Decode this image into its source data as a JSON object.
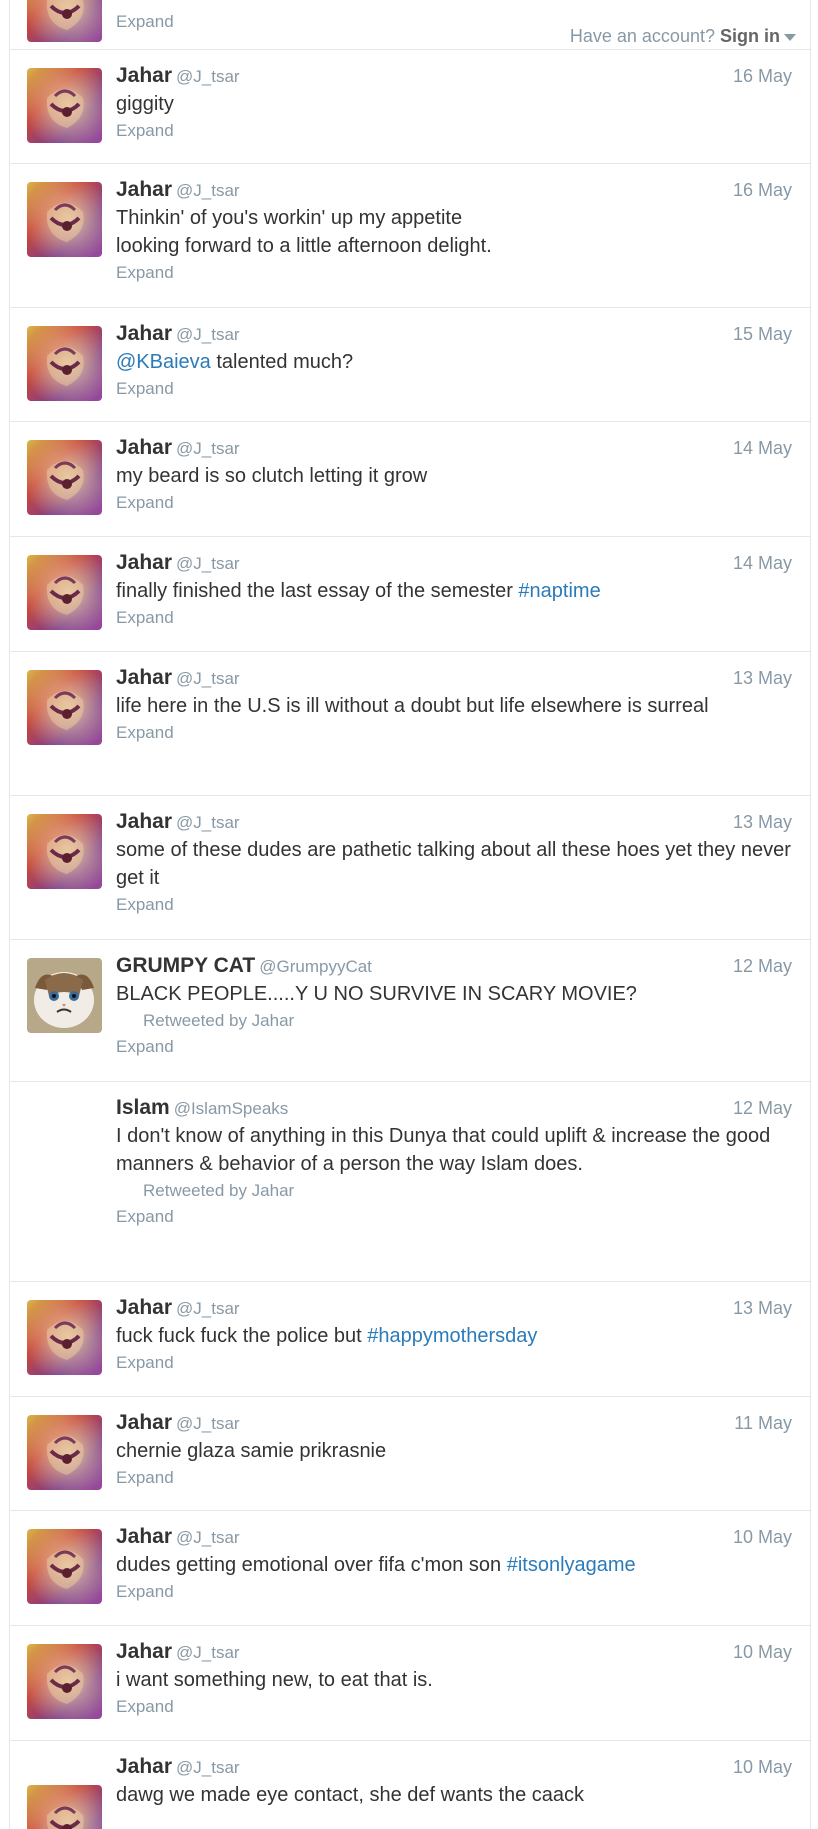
{
  "topbar": {
    "prompt": "Have an account?",
    "signin": "Sign in"
  },
  "expand_label": "Expand",
  "tweets": [
    {
      "name": "Jahar",
      "handle": "@J_tsar",
      "time": "16 May",
      "avatar": "lion",
      "parts": [
        {
          "t": "giggity"
        }
      ]
    },
    {
      "name": "Jahar",
      "handle": "@J_tsar",
      "time": "16 May",
      "avatar": "lion",
      "parts": [
        {
          "t": "Thinkin' of you's workin' up my appetite\nlooking forward to a little afternoon delight."
        }
      ]
    },
    {
      "name": "Jahar",
      "handle": "@J_tsar",
      "time": "15 May",
      "avatar": "lion",
      "parts": [
        {
          "t": "@KBaieva",
          "link": true
        },
        {
          "t": " talented much?"
        }
      ]
    },
    {
      "name": "Jahar",
      "handle": "@J_tsar",
      "time": "14 May",
      "avatar": "lion",
      "parts": [
        {
          "t": "my beard is so clutch letting it grow"
        }
      ]
    },
    {
      "name": "Jahar",
      "handle": "@J_tsar",
      "time": "14 May",
      "avatar": "lion",
      "parts": [
        {
          "t": "finally finished the last essay of the semester "
        },
        {
          "t": "#naptime",
          "link": true
        }
      ]
    },
    {
      "name": "Jahar",
      "handle": "@J_tsar",
      "time": "13 May",
      "avatar": "lion",
      "parts": [
        {
          "t": "life here in the U.S is ill without a doubt but life elsewhere is surreal"
        }
      ]
    },
    {
      "name": "Jahar",
      "handle": "@J_tsar",
      "time": "13 May",
      "avatar": "lion",
      "parts": [
        {
          "t": "some of these dudes are pathetic talking about all these hoes yet they never get it"
        }
      ]
    },
    {
      "name": "GRUMPY CAT",
      "handle": "@GrumpyyCat",
      "time": "12 May",
      "avatar": "cat",
      "retweet": "Retweeted by Jahar",
      "parts": [
        {
          "t": "BLACK PEOPLE.....Y U NO SURVIVE IN SCARY MOVIE?"
        }
      ]
    },
    {
      "name": "Islam",
      "handle": "@IslamSpeaks",
      "time": "12 May",
      "avatar": "none",
      "retweet": "Retweeted by Jahar",
      "parts": [
        {
          "t": "I don't know of anything in this Dunya that could uplift & increase the good manners & behavior of a person the way Islam does."
        }
      ]
    },
    {
      "name": "Jahar",
      "handle": "@J_tsar",
      "time": "13 May",
      "avatar": "lion",
      "parts": [
        {
          "t": "fuck fuck fuck the police but "
        },
        {
          "t": "#happymothersday",
          "link": true
        }
      ]
    },
    {
      "name": "Jahar",
      "handle": "@J_tsar",
      "time": "11 May",
      "avatar": "lion",
      "parts": [
        {
          "t": "chernie glaza samie prikrasnie"
        }
      ]
    },
    {
      "name": "Jahar",
      "handle": "@J_tsar",
      "time": "10 May",
      "avatar": "lion",
      "parts": [
        {
          "t": "dudes getting emotional over fifa c'mon son "
        },
        {
          "t": "#itsonlyagame",
          "link": true
        }
      ]
    },
    {
      "name": "Jahar",
      "handle": "@J_tsar",
      "time": "10 May",
      "avatar": "lion",
      "parts": [
        {
          "t": "i want something new, to eat that is."
        }
      ]
    },
    {
      "name": "Jahar",
      "handle": "@J_tsar",
      "time": "10 May",
      "avatar": "lion",
      "parts": [
        {
          "t": "dawg we made eye contact, she def wants the caack"
        }
      ]
    }
  ],
  "colors": {
    "link": "#2b7bb9",
    "muted": "#8899a6",
    "divider": "#e1e8ed"
  }
}
